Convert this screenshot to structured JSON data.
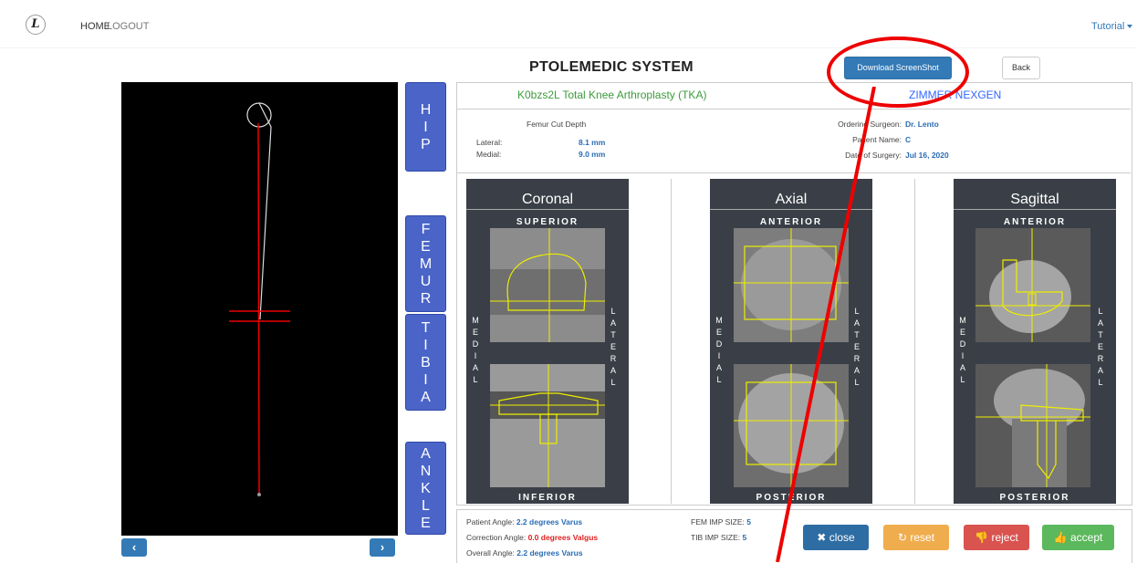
{
  "nav": {
    "logo": "L",
    "home": "HOME",
    "logout": "LOGOUT",
    "tutorial": "Tutorial"
  },
  "header": {
    "title": "PTOLEMEDIC SYSTEM",
    "download": "Download ScreenShot",
    "back": "Back"
  },
  "segments": {
    "hip": [
      "H",
      "I",
      "P"
    ],
    "femur": [
      "F",
      "E",
      "M",
      "U",
      "R"
    ],
    "tibia": [
      "T",
      "I",
      "B",
      "I",
      "A"
    ],
    "ankle": [
      "A",
      "N",
      "K",
      "L",
      "E"
    ]
  },
  "arrows": {
    "left": "‹",
    "right": "›"
  },
  "report": {
    "procedure": "K0bzs2L Total Knee Arthroplasty (TKA)",
    "implant": "ZIMMER NEXGEN",
    "femur_cut_title": "Femur Cut Depth",
    "lateral_label": "Lateral:",
    "lateral_value": "8.1 mm",
    "medial_label": "Medial:",
    "medial_value": "9.0 mm",
    "surgeon_label": "Ordering Surgeon:",
    "surgeon_value": "Dr. Lento",
    "patient_label": "Patient Name:",
    "patient_value": "C",
    "date_label": "Date of Surgery:",
    "date_value": "Jul 16, 2020"
  },
  "views": {
    "coronal": {
      "title": "Coronal",
      "top": "SUPERIOR",
      "bottom": "INFERIOR",
      "left": "MEDIAL",
      "right": "LATERAL"
    },
    "axial": {
      "title": "Axial",
      "top": "ANTERIOR",
      "bottom": "POSTERIOR",
      "left": "MEDIAL",
      "right": "LATERAL"
    },
    "sagittal": {
      "title": "Sagittal",
      "top": "ANTERIOR",
      "bottom": "POSTERIOR",
      "left": "MEDIAL",
      "right": "LATERAL"
    }
  },
  "angles": {
    "patient_label": "Patient Angle:",
    "patient_value": "2.2 degrees Varus",
    "correction_label": "Correction Angle:",
    "correction_value": "0.0 degrees Valgus",
    "overall_label": "Overall Angle:",
    "overall_value": "2.2 degrees Varus",
    "fem_label": "FEM IMP SIZE:",
    "fem_value": "5",
    "tib_label": "TIB IMP SIZE:",
    "tib_value": "5"
  },
  "actions": {
    "close": "close",
    "reset": "reset",
    "reject": "reject",
    "accept": "accept"
  },
  "colors": {
    "primary": "#337ab7",
    "segment": "#4a64c8",
    "close": "#2e6da4",
    "reset": "#f0ad4e",
    "reject": "#d9534f",
    "accept": "#5cb85c",
    "annotation": "#ee0000"
  }
}
